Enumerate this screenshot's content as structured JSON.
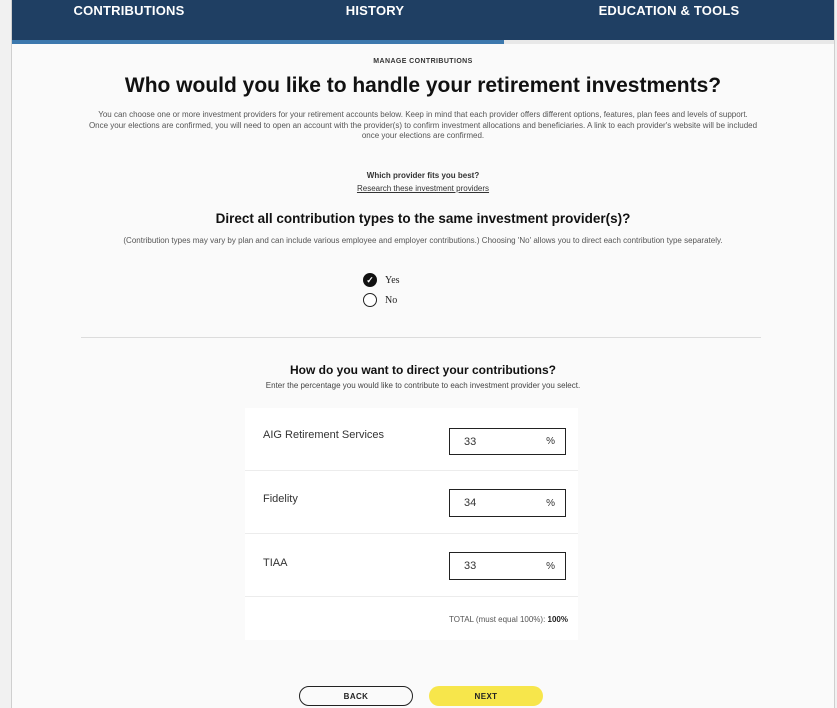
{
  "nav": {
    "tabs": [
      {
        "label": "CONTRIBUTIONS"
      },
      {
        "label": "HISTORY"
      },
      {
        "label": "EDUCATION & TOOLS"
      }
    ]
  },
  "page": {
    "eyebrow": "MANAGE CONTRIBUTIONS",
    "title": "Who would you like to handle your retirement investments?",
    "intro_1": "You can choose one or more investment providers for your retirement accounts below. Keep in mind that each provider offers different options, features, plan fees and levels of support.",
    "intro_2": "Once your elections are confirmed, you will need to open an account with the provider(s) to confirm investment allocations and beneficiaries. A link to each provider's website will be included once your elections are confirmed.",
    "fits_question": "Which provider fits you best?",
    "fits_link": "Research these investment providers"
  },
  "same_provider": {
    "question": "Direct all contribution types to the same investment provider(s)?",
    "note": "(Contribution types may vary by plan and can include various employee and employer contributions.) Choosing 'No' allows you to direct each contribution type separately.",
    "options": [
      {
        "label": "Yes",
        "selected": true
      },
      {
        "label": "No",
        "selected": false
      }
    ]
  },
  "direct": {
    "heading": "How do you want to direct your contributions?",
    "instructions": "Enter the percentage you would like to contribute to each investment provider you select.",
    "providers": [
      {
        "name": "AIG Retirement Services",
        "percent": "33",
        "unit": "%"
      },
      {
        "name": "Fidelity",
        "percent": "34",
        "unit": "%"
      },
      {
        "name": "TIAA",
        "percent": "33",
        "unit": "%"
      }
    ],
    "total_label": "TOTAL (must equal 100%):",
    "total_value": "100%"
  },
  "actions": {
    "back": "BACK",
    "next": "NEXT"
  },
  "colors": {
    "nav_bg": "#1f3f63",
    "nav_active_underline": "#3c78ad",
    "next_button": "#f7e64b"
  }
}
